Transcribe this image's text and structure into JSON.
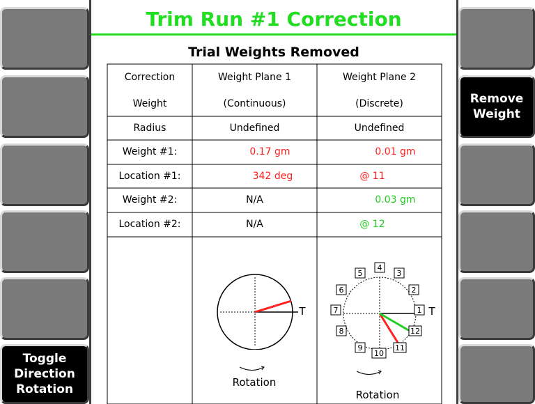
{
  "title": "Trim Run #1 Correction",
  "subtitle": "Trial Weights Removed",
  "softkeys": {
    "left": [
      "",
      "",
      "",
      "",
      "",
      "Toggle Direction Rotation"
    ],
    "right": [
      "",
      "Remove Weight",
      "",
      "",
      "",
      ""
    ]
  },
  "table": {
    "header1": [
      "Correction",
      "Weight Plane 1",
      "Weight Plane 2"
    ],
    "header2": [
      "Weight",
      "(Continuous)",
      "(Discrete)"
    ],
    "radius": [
      "Radius",
      "Undefined",
      "Undefined"
    ],
    "weight1": {
      "label": "Weight #1:",
      "plane1": "0.17  gm",
      "plane2": "0.01  gm"
    },
    "location1": {
      "label": "Location #1:",
      "plane1": "342  deg",
      "plane2": "@ 11"
    },
    "weight2": {
      "label": "Weight #2:",
      "plane1": "N/A",
      "plane2": "0.03  gm"
    },
    "location2": {
      "label": "Location #2:",
      "plane1": "N/A",
      "plane2": "@ 12"
    }
  },
  "plane1_diagram": {
    "ref_label": "T",
    "rotation_label": "Rotation",
    "vector_angle_deg": 342
  },
  "plane2_diagram": {
    "ref_label": "T",
    "rotation_label": "Rotation",
    "positions": [
      "1",
      "2",
      "3",
      "4",
      "5",
      "6",
      "7",
      "8",
      "9",
      "10",
      "11",
      "12"
    ],
    "vectors": [
      {
        "position": 11,
        "color": "#ff2020"
      },
      {
        "position": 12,
        "color": "#22cc22"
      }
    ]
  },
  "colors": {
    "title": "#22dd22",
    "plane1_values": "#ff2020",
    "weight1_plane2": "#ff2020",
    "weight2_plane2": "#22cc22",
    "active_softkey": "#000000",
    "inactive_softkey": "#7a7a7a"
  }
}
